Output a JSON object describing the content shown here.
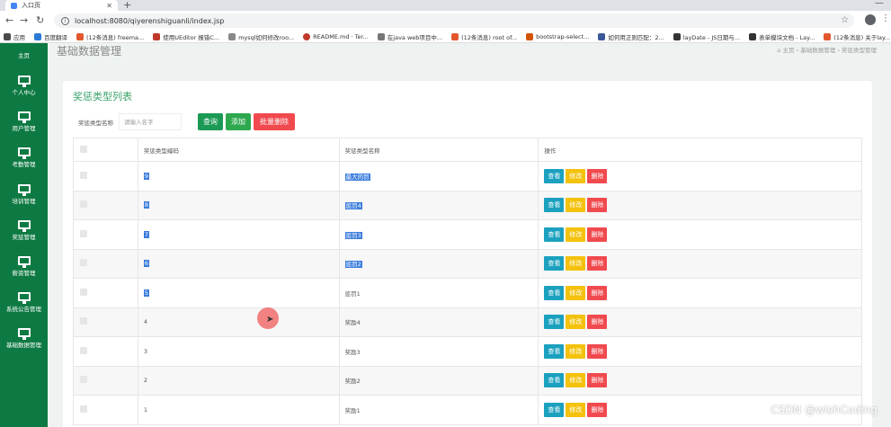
{
  "browser": {
    "tab_title": "入口页",
    "url": "localhost:8080/qiyerenshiguanli/index.jsp",
    "bookmarks": [
      "应用",
      "百度翻译",
      "(12条消息) freema...",
      "使用UEditor 报错C...",
      "mysql如何修改roo...",
      "README.md · Ter...",
      "在java web项目中...",
      "(12条消息) root of...",
      "bootstrap-select...",
      "如何用正则匹配：2...",
      "layDate - JS日期与...",
      "表单模块文档 - Lay...",
      "(12条消息) 关于lay..."
    ],
    "colors": {
      "accent": "#0e7a43"
    }
  },
  "sidebar": {
    "items": [
      "主页",
      "个人中心",
      "用户管理",
      "考勤管理",
      "培训管理",
      "奖惩管理",
      "薪资管理",
      "系统公告管理",
      "基础数据管理"
    ]
  },
  "header": {
    "title": "基础数据管理",
    "breadcrumb": [
      "主页",
      "基础数据管理",
      "奖惩类型管理"
    ]
  },
  "panel": {
    "title": "奖惩类型列表",
    "search_label": "奖惩类型名称",
    "search_placeholder": "请输入名字",
    "query_label": "查询",
    "add_label": "添加",
    "batch_delete_label": "批量删除"
  },
  "table": {
    "headers": [
      "奖惩类型编码",
      "奖惩类型名称",
      "操作"
    ],
    "rows": [
      {
        "code": "9",
        "name": "最大的罚"
      },
      {
        "code": "8",
        "name": "惩罚4"
      },
      {
        "code": "7",
        "name": "惩罚3"
      },
      {
        "code": "6",
        "name": "惩罚2"
      },
      {
        "code": "5",
        "name": "惩罚1"
      },
      {
        "code": "4",
        "name": "奖励4"
      },
      {
        "code": "3",
        "name": "奖励3"
      },
      {
        "code": "2",
        "name": "奖励2"
      },
      {
        "code": "1",
        "name": "奖励1"
      }
    ],
    "actions": {
      "view": "查看",
      "edit": "修改",
      "delete": "删除"
    }
  },
  "watermark": "CSDN @wishCoding"
}
